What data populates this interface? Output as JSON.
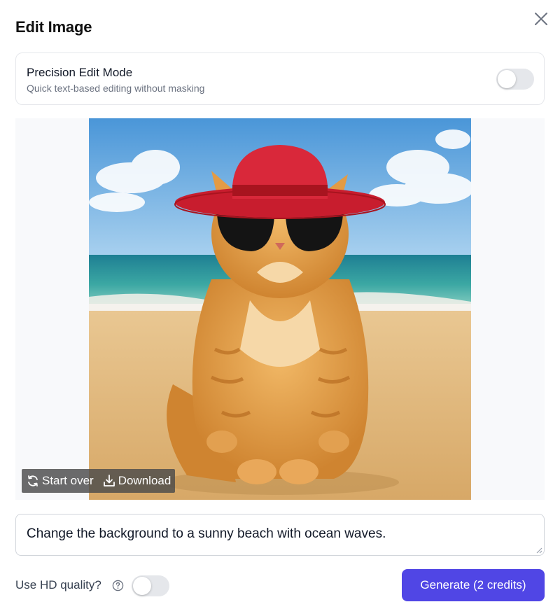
{
  "dialog": {
    "title": "Edit Image"
  },
  "precision_mode": {
    "title": "Precision Edit Mode",
    "description": "Quick text-based editing without masking",
    "enabled": false
  },
  "image": {
    "subject": "orange tabby cat wearing a red hat and black sunglasses sitting on a sunny beach",
    "actions": {
      "start_over_label": "Start over",
      "download_label": "Download"
    }
  },
  "prompt": {
    "value": "Change the background to a sunny beach with ocean waves."
  },
  "footer": {
    "hd_label": "Use HD quality?",
    "hd_enabled": false,
    "generate_label": "Generate (2 credits)"
  },
  "colors": {
    "accent": "#5046e5",
    "toggle_off": "#e5e7eb",
    "border": "#e5e7eb"
  },
  "icons": [
    "close-icon",
    "refresh-icon",
    "download-icon",
    "help-circle-icon",
    "resize-grip-icon"
  ]
}
